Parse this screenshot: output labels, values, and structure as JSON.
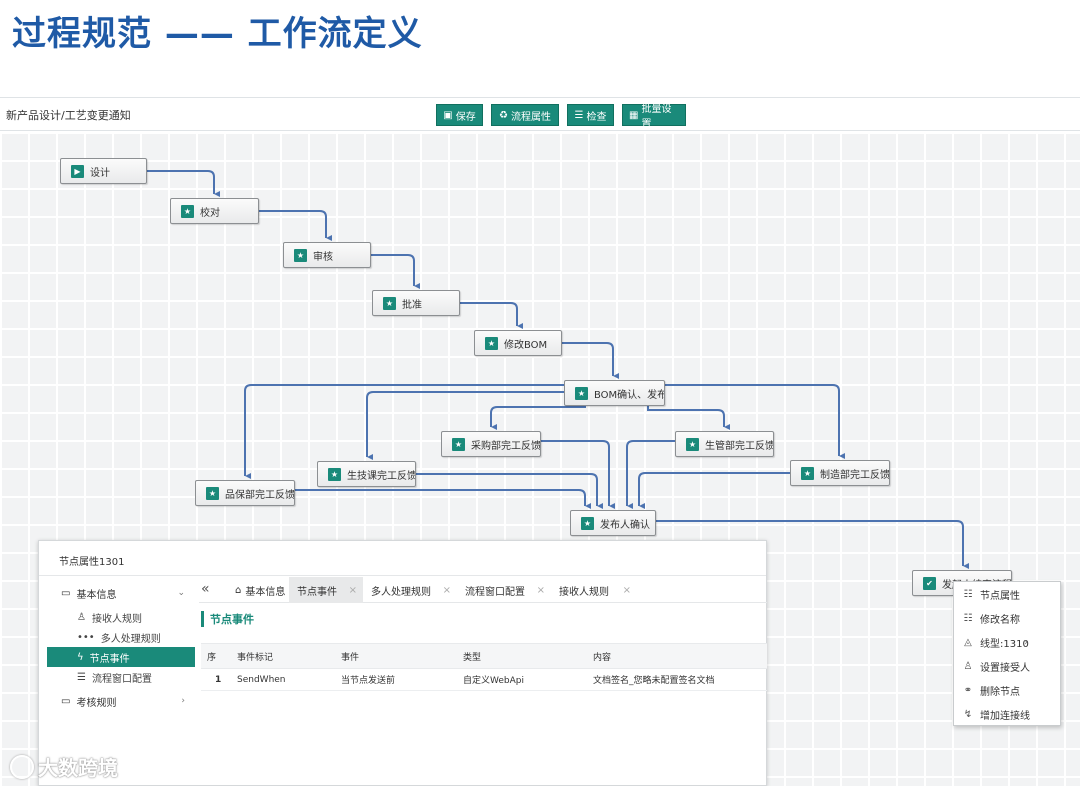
{
  "slide_title": "过程规范 —— 工作流定义",
  "topbar": {
    "path": "新产品设计/工艺变更通知",
    "buttons": [
      {
        "label": "保存",
        "icon": "save-icon",
        "glyph": "▣"
      },
      {
        "label": "流程属性",
        "icon": "recycle-icon",
        "glyph": "♻"
      },
      {
        "label": "检查",
        "icon": "checklist-icon",
        "glyph": "☰"
      },
      {
        "label": "批量设置",
        "icon": "batch-icon",
        "glyph": "▦"
      }
    ]
  },
  "nodes": [
    {
      "label": "设计",
      "icon": "play-icon",
      "glyph": "▶"
    },
    {
      "label": "校对",
      "icon": "star-icon",
      "glyph": "★"
    },
    {
      "label": "审核",
      "icon": "star-icon",
      "glyph": "★"
    },
    {
      "label": "批准",
      "icon": "star-icon",
      "glyph": "★"
    },
    {
      "label": "修改BOM",
      "icon": "star-icon",
      "glyph": "★"
    },
    {
      "label": "BOM确认、发布",
      "icon": "star-icon",
      "glyph": "★"
    },
    {
      "label": "采购部完工反馈",
      "icon": "star-icon",
      "glyph": "★"
    },
    {
      "label": "生管部完工反馈",
      "icon": "star-icon",
      "glyph": "★"
    },
    {
      "label": "生技课完工反馈",
      "icon": "star-icon",
      "glyph": "★"
    },
    {
      "label": "制造部完工反馈",
      "icon": "star-icon",
      "glyph": "★"
    },
    {
      "label": "品保部完工反馈",
      "icon": "star-icon",
      "glyph": "★"
    },
    {
      "label": "发布人确认",
      "icon": "star-icon",
      "glyph": "★"
    },
    {
      "label": "发起人结束流程",
      "icon": "check-icon",
      "glyph": "✔"
    }
  ],
  "props": {
    "title": "节点属性1301",
    "sidebar": {
      "groups": [
        {
          "label": "基本信息",
          "icon": "folder-icon",
          "glyph": "▭",
          "chevron": "⌄"
        },
        {
          "label": "考核规则",
          "icon": "folder-icon",
          "glyph": "▭",
          "chevron": "›"
        }
      ],
      "items": [
        {
          "label": "接收人规则",
          "icon": "user-rule-icon",
          "glyph": "♙"
        },
        {
          "label": "多人处理规则",
          "icon": "more-icon",
          "glyph": "•••"
        },
        {
          "label": "节点事件",
          "icon": "lightning-icon",
          "glyph": "ϟ"
        },
        {
          "label": "流程窗口配置",
          "icon": "list-icon",
          "glyph": "☰"
        }
      ]
    },
    "tabs": [
      {
        "label": "基本信息",
        "icon": "home-icon",
        "glyph": "⌂",
        "closable": false
      },
      {
        "label": "节点事件",
        "closable": true
      },
      {
        "label": "多人处理规则",
        "closable": true
      },
      {
        "label": "流程窗口配置",
        "closable": true
      },
      {
        "label": "接收人规则",
        "closable": true
      }
    ],
    "tab_nav": "«",
    "close_glyph": "×",
    "section_title": "节点事件",
    "table": {
      "columns": [
        "序",
        "事件标记",
        "事件",
        "类型",
        "内容"
      ],
      "rows": [
        [
          "1",
          "SendWhen",
          "当节点发送前",
          "自定义WebApi",
          "文档签名_您略未配置签名文档"
        ]
      ]
    }
  },
  "context_menu": [
    {
      "label": "节点属性",
      "icon": "sliders-icon",
      "glyph": "☷"
    },
    {
      "label": "修改名称",
      "icon": "edit-icon",
      "glyph": "☷"
    },
    {
      "label": "线型:1310",
      "icon": "line-type-icon",
      "glyph": "◬",
      "submenu": "›"
    },
    {
      "label": "设置接受人",
      "icon": "person-icon",
      "glyph": "♙"
    },
    {
      "label": "删除节点",
      "icon": "link-icon",
      "glyph": "⚭"
    },
    {
      "label": "增加连接线",
      "icon": "connector-icon",
      "glyph": "↯"
    }
  ],
  "watermark": "大数跨境",
  "colors": {
    "accent": "#1a8a7a",
    "edge": "#4d73b0",
    "title": "#1f5aa6"
  }
}
